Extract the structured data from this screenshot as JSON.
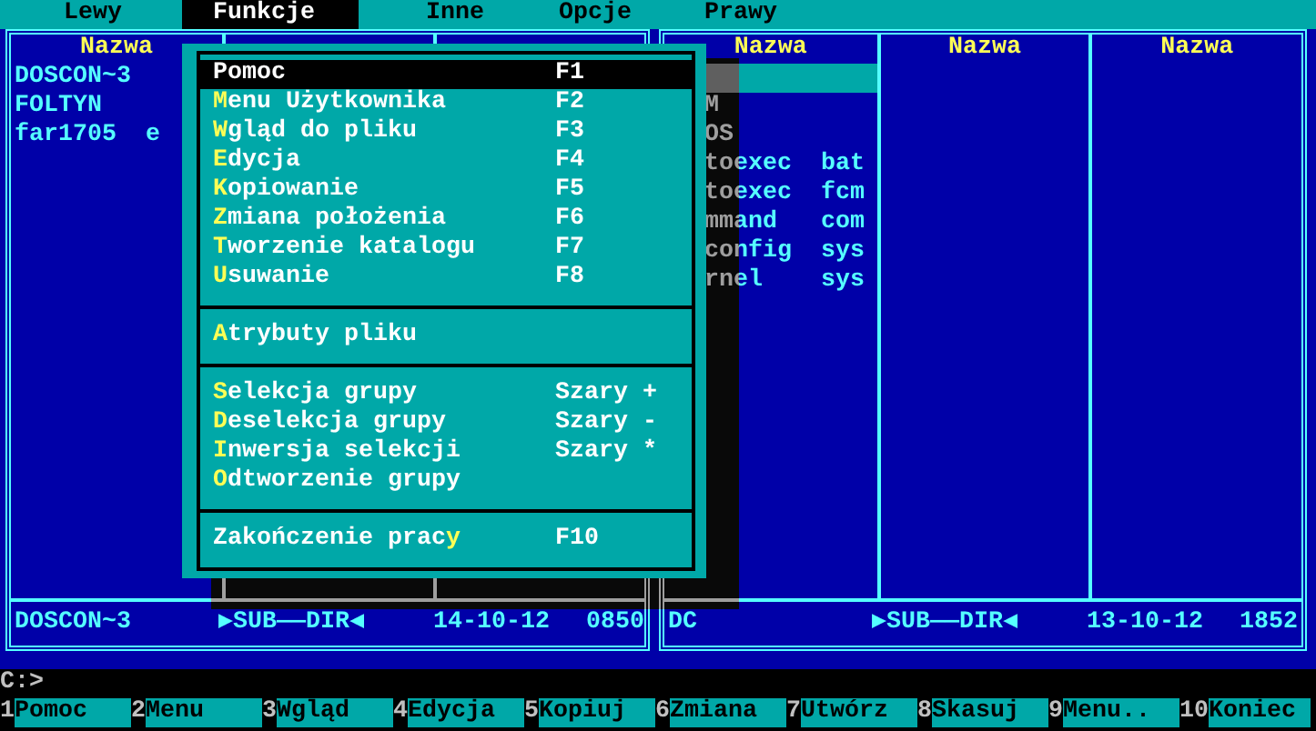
{
  "menu_bar": [
    {
      "label": "Lewy",
      "selected": false
    },
    {
      "label": "Funkcje",
      "selected": true
    },
    {
      "label": "Inne",
      "selected": false
    },
    {
      "label": "Opcje",
      "selected": false
    },
    {
      "label": "Prawy",
      "selected": false
    }
  ],
  "left_panel": {
    "headers": [
      "Nazwa"
    ],
    "files": [
      {
        "name": "DOSCON~3",
        "selected": false
      },
      {
        "name": "FOLTYN",
        "selected": false
      },
      {
        "name": "far1705",
        "ext": "e",
        "selected": false
      }
    ],
    "info": {
      "name": "DOSCON~3",
      "type": "▶SUB——DIR◀",
      "date": "14-10-12",
      "time": "0850"
    }
  },
  "right_panel": {
    "headers": [
      "Nazwa",
      "Nazwa",
      "Nazwa"
    ],
    "files": [
      {
        "selected": true
      },
      {
        "name": "M",
        "selected": false
      },
      {
        "name": "OS",
        "selected": false
      },
      {
        "name": "toexec",
        "ext": "bat",
        "selected": false
      },
      {
        "name": "toexec",
        "ext": "fcm",
        "selected": false
      },
      {
        "name": "mmand",
        "ext": "com",
        "selected": false
      },
      {
        "name": "config",
        "ext": "sys",
        "selected": false
      },
      {
        "name": "rnel",
        "ext": "sys",
        "selected": false
      }
    ],
    "info": {
      "name": "DC",
      "type": "▶SUB——DIR◀",
      "date": "13-10-12",
      "time": "1852"
    }
  },
  "dropdown": [
    {
      "kind": "item",
      "key": "P",
      "after": "omoc",
      "shortcut": "F1",
      "selected": true
    },
    {
      "kind": "item",
      "key": "M",
      "after": "enu Użytkownika",
      "shortcut": "F2",
      "selected": false
    },
    {
      "kind": "item",
      "key": "W",
      "after": "gląd do pliku",
      "shortcut": "F3",
      "selected": false
    },
    {
      "kind": "item",
      "key": "E",
      "after": "dycja",
      "shortcut": "F4",
      "selected": false
    },
    {
      "kind": "item",
      "key": "K",
      "after": "opiowanie",
      "shortcut": "F5",
      "selected": false
    },
    {
      "kind": "item",
      "key": "Z",
      "after": "miana położenia",
      "shortcut": "F6",
      "selected": false
    },
    {
      "kind": "item",
      "key": "T",
      "after": "worzenie katalogu",
      "shortcut": "F7",
      "selected": false
    },
    {
      "kind": "item",
      "key": "U",
      "after": "suwanie",
      "shortcut": "F8",
      "selected": false
    },
    {
      "kind": "separator"
    },
    {
      "kind": "item",
      "key": "A",
      "after": "trybuty pliku",
      "selected": false
    },
    {
      "kind": "separator"
    },
    {
      "kind": "item",
      "key": "S",
      "after": "elekcja grupy",
      "shortcut": "Szary +",
      "selected": false
    },
    {
      "kind": "item",
      "key": "D",
      "after": "eselekcja grupy",
      "shortcut": "Szary -",
      "selected": false
    },
    {
      "kind": "item",
      "key": "I",
      "after": "nwersja selekcji",
      "shortcut": "Szary *",
      "selected": false
    },
    {
      "kind": "item",
      "key": "O",
      "after": "dtworzenie grupy",
      "selected": false
    },
    {
      "kind": "separator"
    },
    {
      "kind": "item",
      "before": "Zakończenie prac",
      "key": "y",
      "shortcut": "F10",
      "selected": false
    }
  ],
  "command_line": {
    "prompt": "C:>"
  },
  "function_keys": [
    {
      "number": "1",
      "label": "Pomoc"
    },
    {
      "number": "2",
      "label": "Menu"
    },
    {
      "number": "3",
      "label": "Wgląd"
    },
    {
      "number": "4",
      "label": "Edycja"
    },
    {
      "number": "5",
      "label": "Kopiuj"
    },
    {
      "number": "6",
      "label": "Zmiana"
    },
    {
      "number": "7",
      "label": "Utwórz"
    },
    {
      "number": "8",
      "label": "Skasuj"
    },
    {
      "number": "9",
      "label": "Menu.."
    },
    {
      "number": "10",
      "label": "Koniec"
    }
  ]
}
